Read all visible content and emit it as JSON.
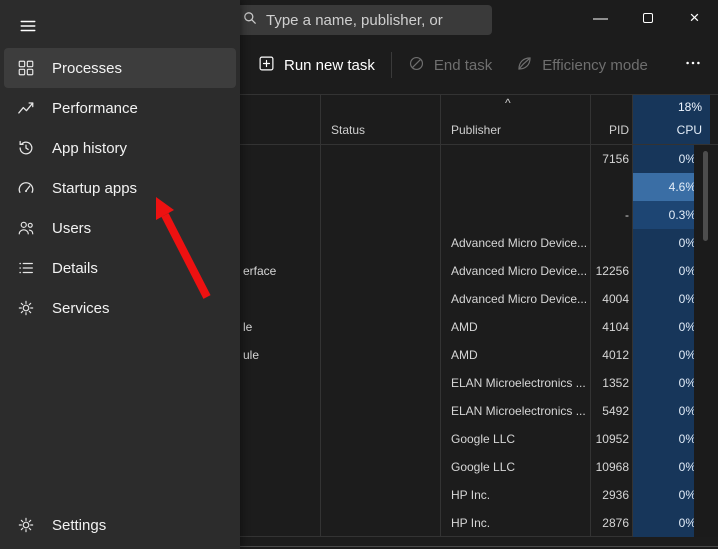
{
  "titlebar": {
    "search_placeholder": "Type a name, publisher, or"
  },
  "icons": {
    "minimize": "—",
    "close": "×",
    "more": "···",
    "sort_caret": "^"
  },
  "toolbar": {
    "run_new_task": "Run new task",
    "end_task": "End task",
    "efficiency_mode": "Efficiency mode"
  },
  "sidebar": {
    "items": [
      {
        "label": "Processes",
        "selected": true
      },
      {
        "label": "Performance",
        "selected": false
      },
      {
        "label": "App history",
        "selected": false
      },
      {
        "label": "Startup apps",
        "selected": false
      },
      {
        "label": "Users",
        "selected": false
      },
      {
        "label": "Details",
        "selected": false
      },
      {
        "label": "Services",
        "selected": false
      }
    ],
    "settings_label": "Settings"
  },
  "table": {
    "columns": {
      "status": "Status",
      "publisher": "Publisher",
      "pid": "PID",
      "cpu": "CPU"
    },
    "cpu_total": "18%",
    "heat_colors": {
      "low": "#17365a",
      "mid": "#1d4573",
      "high": "#3a6ea5"
    },
    "rows": [
      {
        "name_fragment": "",
        "publisher": "",
        "pid": "7156",
        "cpu": "0%",
        "heat": "low"
      },
      {
        "name_fragment": "",
        "publisher": "",
        "pid": "",
        "cpu": "4.6%",
        "heat": "high"
      },
      {
        "name_fragment": "",
        "publisher": "",
        "pid": "-",
        "cpu": "0.3%",
        "heat": "mid"
      },
      {
        "name_fragment": "",
        "publisher": "Advanced Micro Device...",
        "pid": "",
        "cpu": "0%",
        "heat": "low"
      },
      {
        "name_fragment": "erface",
        "publisher": "Advanced Micro Device...",
        "pid": "12256",
        "cpu": "0%",
        "heat": "low"
      },
      {
        "name_fragment": "",
        "publisher": "Advanced Micro Device...",
        "pid": "4004",
        "cpu": "0%",
        "heat": "low"
      },
      {
        "name_fragment": "le",
        "publisher": "AMD",
        "pid": "4104",
        "cpu": "0%",
        "heat": "low"
      },
      {
        "name_fragment": "ule",
        "publisher": "AMD",
        "pid": "4012",
        "cpu": "0%",
        "heat": "low"
      },
      {
        "name_fragment": "",
        "publisher": "ELAN Microelectronics ...",
        "pid": "1352",
        "cpu": "0%",
        "heat": "low"
      },
      {
        "name_fragment": "",
        "publisher": "ELAN Microelectronics ...",
        "pid": "5492",
        "cpu": "0%",
        "heat": "low"
      },
      {
        "name_fragment": "",
        "publisher": "Google LLC",
        "pid": "10952",
        "cpu": "0%",
        "heat": "low"
      },
      {
        "name_fragment": "",
        "publisher": "Google LLC",
        "pid": "10968",
        "cpu": "0%",
        "heat": "low"
      },
      {
        "name_fragment": "",
        "publisher": "HP Inc.",
        "pid": "2936",
        "cpu": "0%",
        "heat": "low"
      },
      {
        "name_fragment": "",
        "publisher": "HP Inc.",
        "pid": "2876",
        "cpu": "0%",
        "heat": "low"
      }
    ]
  },
  "colors": {
    "arrow_red": "#ed1111",
    "cpu_column_blue": "#17365a"
  }
}
